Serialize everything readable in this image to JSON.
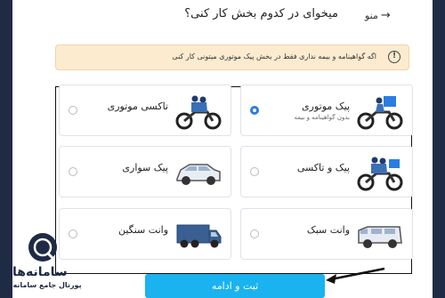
{
  "header": {
    "title": "میخوای در کدوم بخش کار کنی؟",
    "back_label": "منو"
  },
  "notice": {
    "text": "اگه گواهینامه و بیمه نداری فقط در بخش پیک موتوری میتونی کار کنی"
  },
  "options": [
    {
      "label": "پیک موتوری",
      "sub": "بدون گواهینامه و بیمه",
      "selected": true,
      "icon": "motorcycle-courier-icon"
    },
    {
      "label": "تاکسی موتوری",
      "sub": "",
      "selected": false,
      "icon": "motorcycle-taxi-icon"
    },
    {
      "label": "پیک و تاکسی",
      "sub": "",
      "selected": false,
      "icon": "motorcycle-courier-taxi-icon"
    },
    {
      "label": "پیک سواری",
      "sub": "",
      "selected": false,
      "icon": "car-icon"
    },
    {
      "label": "وانت سبک",
      "sub": "",
      "selected": false,
      "icon": "light-van-icon"
    },
    {
      "label": "وانت سنگین",
      "sub": "",
      "selected": false,
      "icon": "heavy-truck-icon"
    }
  ],
  "submit": {
    "label": "ثبت و ادامه"
  },
  "watermark": {
    "brand": "سامانه‌ها",
    "tagline": "پورتال جامع سامانه‌ها"
  },
  "colors": {
    "accent": "#1ab3ef",
    "radio_selected": "#2a7de1",
    "notice_bg": "#fdebd0",
    "side_bars": "#1f2a44"
  }
}
